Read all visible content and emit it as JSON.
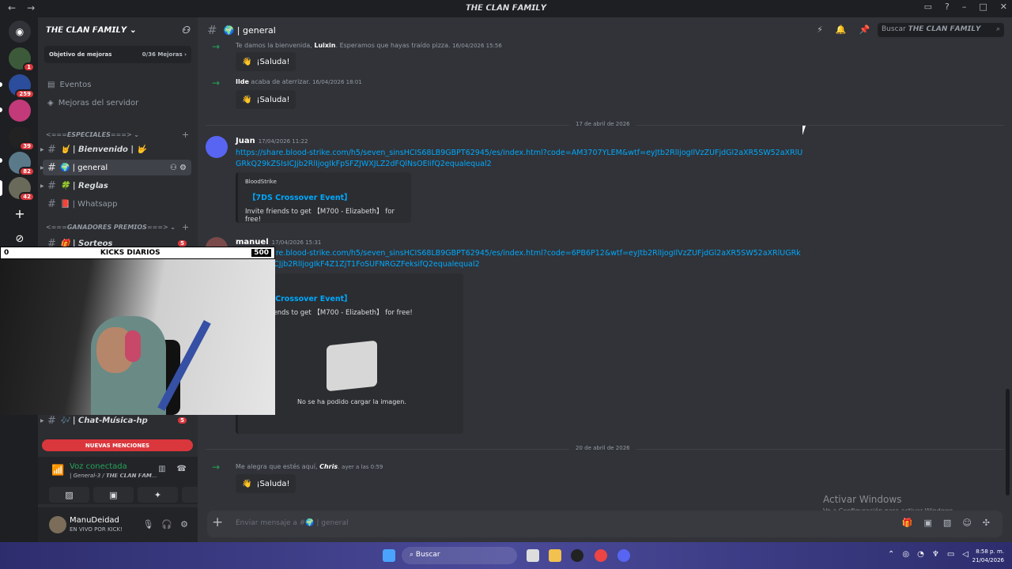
{
  "window": {
    "title": "𝙏𝙃𝙀 𝘾𝙇𝘼𝙉 𝙁𝘼𝙈𝙄𝙇𝙔",
    "back": "←",
    "forward": "→"
  },
  "server_rail": {
    "badges": [
      "1",
      "259",
      "39",
      "82",
      "42"
    ]
  },
  "guild": {
    "name": "𝙏𝙃𝙀 𝘾𝙇𝘼𝙉 𝙁𝘼𝙈𝙄𝙇𝙔",
    "boost_label": "Objetivo de mejoras",
    "boost_count": "0/36 Mejoras",
    "events": "Eventos",
    "boosts": "Mejoras del servidor",
    "category1": "<===𝙀𝙎𝙋𝙀𝘾𝙄𝘼𝙇𝙀𝙎===>",
    "category2": "<===𝙂𝘼𝙉𝘼𝘿𝙊𝙍𝙀𝙎 𝙋𝙍𝙀𝙈𝙄𝙊𝙎===>",
    "channels": [
      {
        "name": "🤘 | 𝘽𝙞𝙚𝙣𝙫𝙚𝙣𝙞𝙙𝙤 | 🤟"
      },
      {
        "name": "🌍 | general"
      },
      {
        "name": "🍀 | 𝙍𝙚𝙜𝙡𝙖𝙨"
      },
      {
        "name": "📕 | Whatsapp"
      },
      {
        "name": "🎁 | 𝙎𝙤𝙧𝙩𝙚𝙤𝙨",
        "badge": "5"
      },
      {
        "name": "🎶 | 𝘾𝙝𝙖𝙩-𝙈𝙪́𝙨𝙞𝙘𝙖-𝙝𝙥",
        "badge": "5"
      }
    ],
    "mentions_pill": "NUEVAS MENCIONES"
  },
  "webcam": {
    "left_value": "0",
    "label": "KICKS DIARIOS",
    "right_value": "500"
  },
  "voice": {
    "status": "Voz conectada",
    "channel": "| General-3 / 𝙏𝙃𝙀 𝘾𝙇𝘼𝙉 𝙁𝘼𝙈..."
  },
  "user": {
    "name": "ManuDeidad",
    "status": "EN VIVO POR KICK!"
  },
  "channel_header": {
    "name": "🌍 | general"
  },
  "search": {
    "prefix": "Buscar ",
    "server": "𝙏𝙃𝙀 𝘾𝙇𝘼𝙉 𝙁𝘼𝙈𝙄𝙇𝙔"
  },
  "messages": {
    "m1": {
      "pre": "Te damos la bienvenida, ",
      "user": "Luixin",
      "post": ". Esperamos que hayas traído pizza.",
      "ts": "16/04/2026 15:56"
    },
    "saluda": "¡Saluda!",
    "m2": {
      "user": "Ilde",
      "post": " acaba de aterrizar.",
      "ts": "16/04/2026 18:01"
    },
    "date1": "17 de abril de 2026",
    "m3": {
      "user": "Juan",
      "ts": "17/04/2026 11:22",
      "link": "https://share.blood-strike.com/h5/seven_sinsHCIS68LB9GBPT62945/es/index.html?code=AM3707YLEM&wtf=eyJtb2RlIjogIlVzZUFjdGl2aXR5SW52aXRlUGRkQ29kZSIsICJjb2RlIjogIkFpSFZJWXJLZ2dFQlNsOEIifQ2equalequal2",
      "embed_provider": "BloodStrike",
      "embed_title": "【7DS Crossover Event】",
      "embed_desc": "Invite friends to get 【M700 - Elizabeth】 for free!"
    },
    "m4": {
      "user": "manuel",
      "ts": "17/04/2026 15:31",
      "link": "https://share.blood-strike.com/h5/seven_sinsHCIS68LB9GBPT62945/es/index.html?code=6PB6P12&wtf=eyJtb2RlIjogIlVzZUFjdGl2aXR5SW52aXRlUGRkQ29kZSIsICJjb2RlIjogIkF4Z1ZjT1FoSUFNRGZFeksifQ2equalequal2",
      "embed_title": "【7DS Crossover Event】",
      "embed_desc": "Invite friends to get 【M700 - Elizabeth】 for free!",
      "image_error": "No se ha podido cargar la imagen."
    },
    "date2": "20 de abril de 2026",
    "m5": {
      "pre": "Me alegra que estés aquí, ",
      "user": "𝘾𝙝𝙧𝙞𝙨",
      "post": ".",
      "ts": "ayer a las 0:59"
    }
  },
  "composer": {
    "placeholder": "Enviar mensaje a #🌍 | general"
  },
  "watermark": {
    "line1": "Activar Windows",
    "line2": "Ve a Configuración para activar Windows."
  },
  "taskbar": {
    "search": "Buscar",
    "time": "8:58 p. m.",
    "date": "21/04/2026"
  }
}
